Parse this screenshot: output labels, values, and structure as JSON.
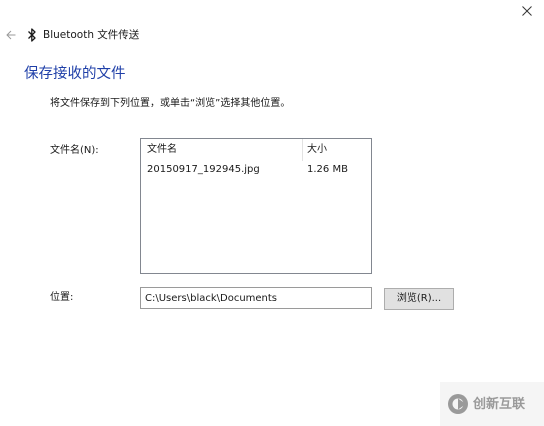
{
  "window": {
    "title": "Bluetooth 文件传送"
  },
  "page": {
    "title": "保存接收的文件",
    "instruction": "将文件保存到下列位置，或单击“浏览”选择其他位置。"
  },
  "files": {
    "label": "文件名(N):",
    "columns": [
      "文件名",
      "大小"
    ],
    "rows": [
      {
        "name": "20150917_192945.jpg",
        "size": "1.26 MB"
      }
    ]
  },
  "location": {
    "label": "位置:",
    "value": "C:\\Users\\black\\Documents",
    "browse_label": "浏览(R)..."
  },
  "watermark": {
    "text": "创新互联"
  },
  "icons": {
    "close": "close-icon",
    "back": "back-arrow-icon",
    "bluetooth": "bluetooth-icon",
    "logo": "watermark-logo-icon"
  },
  "colors": {
    "title_blue": "#1f3fa8",
    "button_bg": "#e1e1e1",
    "list_border": "#828790"
  }
}
